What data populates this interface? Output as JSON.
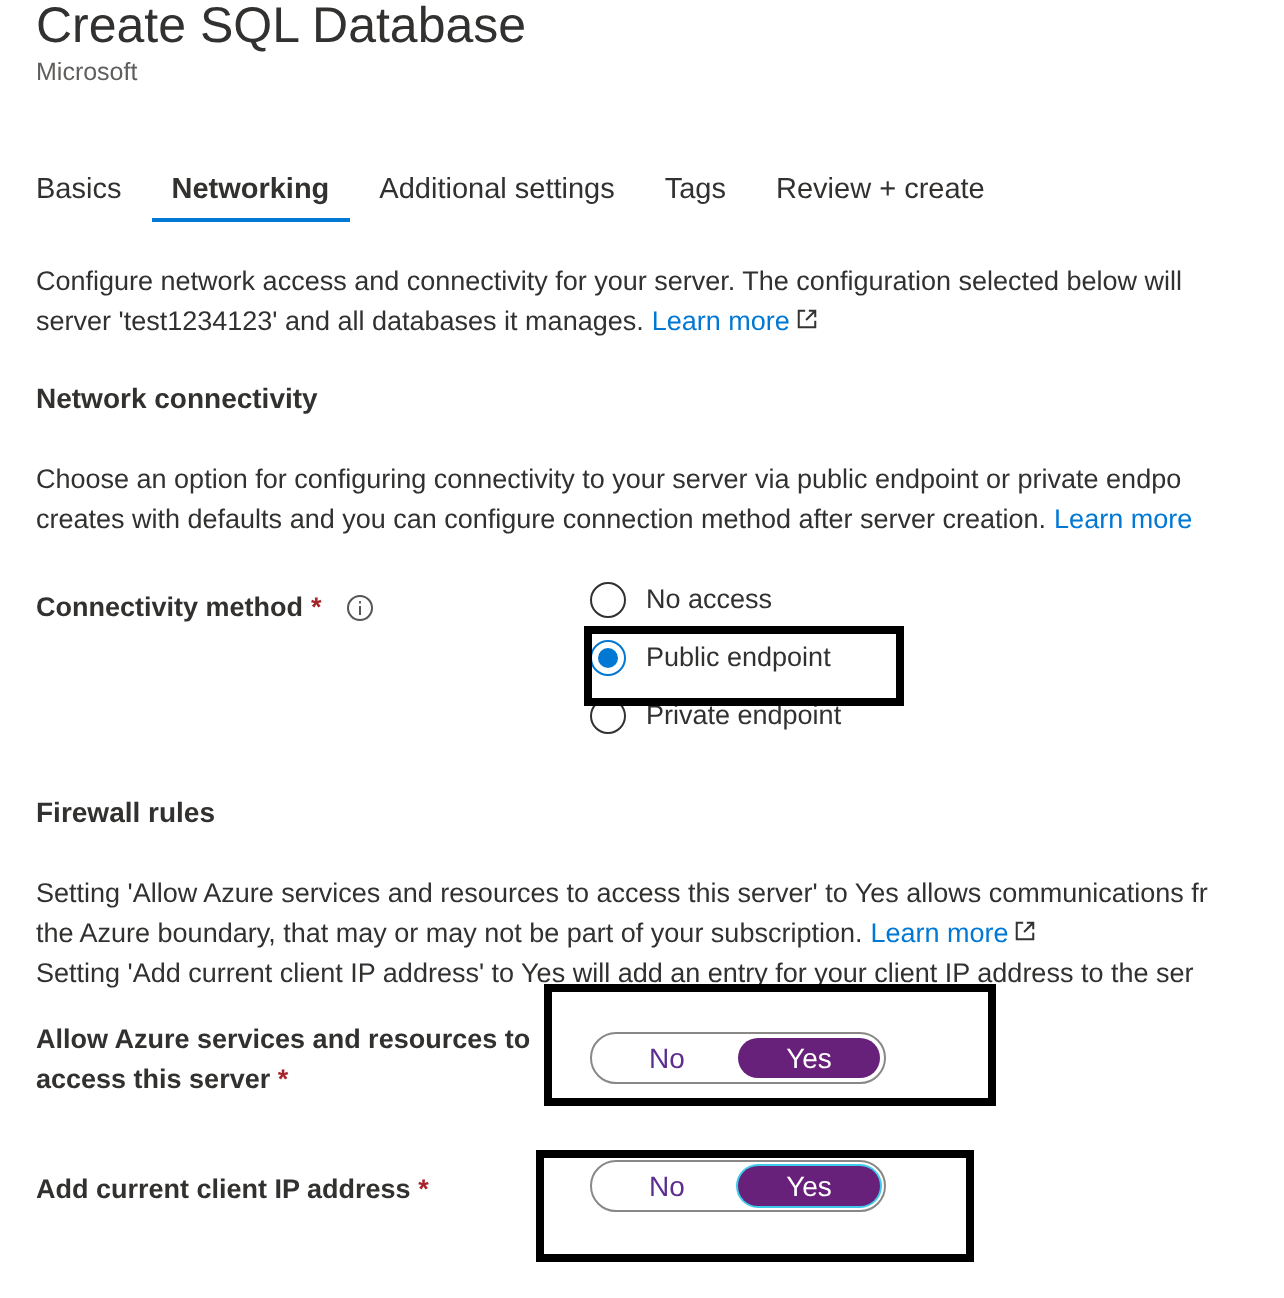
{
  "header": {
    "title": "Create SQL Database",
    "subtitle": "Microsoft"
  },
  "tabs": [
    {
      "label": "Basics",
      "selected": false
    },
    {
      "label": "Networking",
      "selected": true
    },
    {
      "label": "Additional settings",
      "selected": false
    },
    {
      "label": "Tags",
      "selected": false
    },
    {
      "label": "Review + create",
      "selected": false
    }
  ],
  "intro": {
    "lines": [
      "Configure network access and connectivity for your server. The configuration selected below will",
      "server 'test1234123' and all databases it manages."
    ],
    "link": "Learn more"
  },
  "network_connectivity": {
    "heading": "Network connectivity",
    "lines": [
      "Choose an option for configuring connectivity to your server via public endpoint or private endpo",
      "creates with defaults and you can configure connection method after server creation."
    ],
    "link": "Learn more",
    "connectivity_method": {
      "label": "Connectivity method",
      "required": "*",
      "options": [
        {
          "label": "No access",
          "selected": false
        },
        {
          "label": "Public endpoint",
          "selected": true
        },
        {
          "label": "Private endpoint",
          "selected": false
        }
      ]
    }
  },
  "firewall_rules": {
    "heading": "Firewall rules",
    "lines": [
      {
        "text": "Setting 'Allow Azure services and resources to access this server' to Yes allows communications fr"
      },
      {
        "text": "the Azure boundary, that may or may not be part of your subscription.",
        "link": "Learn more"
      },
      {
        "text": "Setting 'Add current client IP address' to Yes will add an entry for your client IP address to the ser"
      }
    ],
    "toggles": [
      {
        "label": "Allow Azure services and resources to access this server",
        "required": "*",
        "off_label": "No",
        "on_label": "Yes",
        "on": true,
        "focused": false
      },
      {
        "label": "Add current client IP address",
        "required": "*",
        "off_label": "No",
        "on_label": "Yes",
        "on": true,
        "focused": true
      }
    ]
  }
}
